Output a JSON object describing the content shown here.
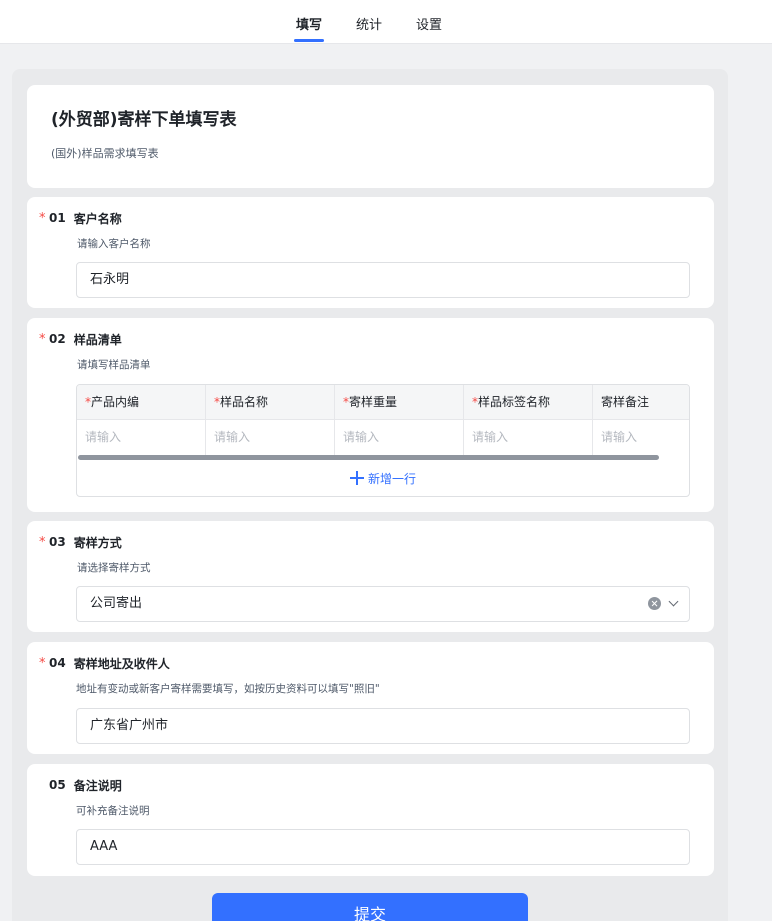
{
  "tabs": [
    {
      "label": "填写",
      "active": true
    },
    {
      "label": "统计",
      "active": false
    },
    {
      "label": "设置",
      "active": false
    }
  ],
  "form": {
    "title": "(外贸部)寄样下单填写表",
    "subtitle": "(国外)样品需求填写表"
  },
  "questions": {
    "q1": {
      "required": "*",
      "number": "01",
      "title": "客户名称",
      "desc": "请输入客户名称",
      "value": "石永明"
    },
    "q2": {
      "required": "*",
      "number": "02",
      "title": "样品清单",
      "desc": "请填写样品清单",
      "columns": [
        {
          "required": "*",
          "label": "产品内编"
        },
        {
          "required": "*",
          "label": "样品名称"
        },
        {
          "required": "*",
          "label": "寄样重量"
        },
        {
          "required": "*",
          "label": "样品标签名称"
        },
        {
          "required": "",
          "label": "寄样备注"
        }
      ],
      "placeholder": "请输入",
      "add_row_label": "新增一行"
    },
    "q3": {
      "required": "*",
      "number": "03",
      "title": "寄样方式",
      "desc": "请选择寄样方式",
      "value": "公司寄出"
    },
    "q4": {
      "required": "*",
      "number": "04",
      "title": "寄样地址及收件人",
      "desc": "地址有变动或新客户寄样需要填写，如按历史资料可以填写\"照旧\"",
      "value": "广东省广州市"
    },
    "q5": {
      "required": "",
      "number": "05",
      "title": "备注说明",
      "desc": "可补充备注说明",
      "value": "AAA"
    }
  },
  "submit_label": "提交",
  "colors": {
    "accent": "#3370ff",
    "required": "#f54a45",
    "background": "#f0f1f3"
  },
  "icons": [
    "plus-icon",
    "clear-icon",
    "chevron-down-icon"
  ]
}
